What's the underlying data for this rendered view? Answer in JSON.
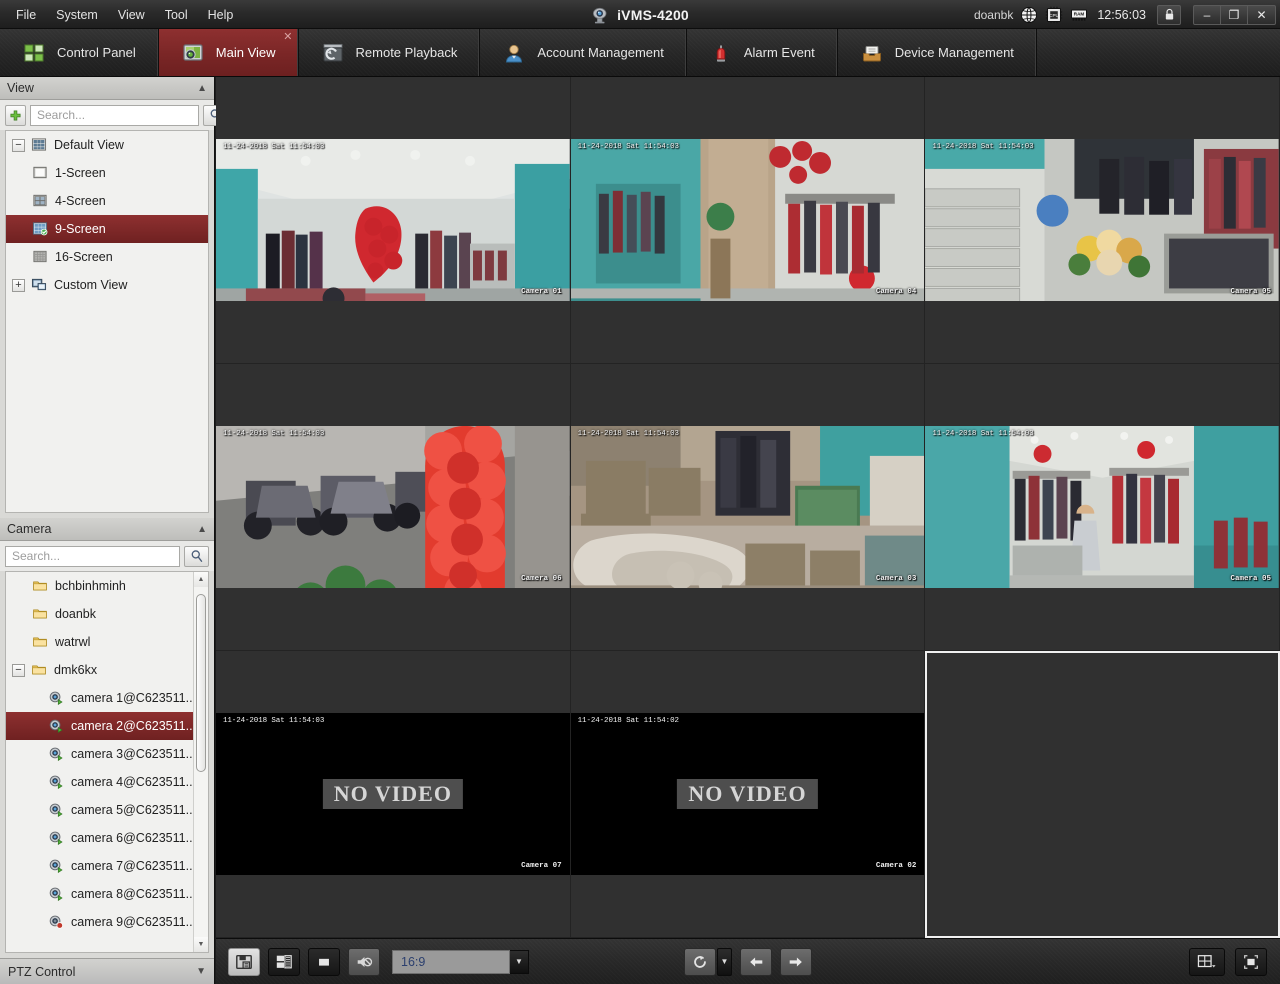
{
  "titlebar": {
    "menus": [
      "File",
      "System",
      "View",
      "Tool",
      "Help"
    ],
    "app_title": "iVMS-4200",
    "logo_icon": "camera-logo-icon",
    "user": "doanbk",
    "status_icons": [
      "globe-icon",
      "cpu-icon",
      "ram-icon"
    ],
    "time": "12:56:03",
    "lock_icon": "lock-icon",
    "minimize_label": "–",
    "restore_label": "❐",
    "close_label": "✕"
  },
  "tabs": [
    {
      "label": "Control Panel",
      "icon": "grid-panel-icon",
      "active": false,
      "closable": false
    },
    {
      "label": "Main View",
      "icon": "monitor-icon",
      "active": true,
      "closable": true,
      "close_label": "✕"
    },
    {
      "label": "Remote Playback",
      "icon": "playback-icon",
      "active": false,
      "closable": false
    },
    {
      "label": "Account Management",
      "icon": "user-icon",
      "active": false,
      "closable": false
    },
    {
      "label": "Alarm Event",
      "icon": "alarm-light-icon",
      "active": false,
      "closable": false
    },
    {
      "label": "Device Management",
      "icon": "device-box-icon",
      "active": false,
      "closable": false
    }
  ],
  "view_panel": {
    "title": "View",
    "collapse_icon": "chevron-up-icon",
    "add_icon": "plus-icon",
    "search_placeholder": "Search...",
    "search_value": "",
    "search_icon": "search-icon",
    "tree": [
      {
        "label": "Default View",
        "icon": "grid-view-icon",
        "expander": "−",
        "level": 0,
        "selected": false
      },
      {
        "label": "1-Screen",
        "icon": "screen-1-icon",
        "expander": "",
        "level": 1,
        "selected": false
      },
      {
        "label": "4-Screen",
        "icon": "screen-4-icon",
        "expander": "",
        "level": 1,
        "selected": false
      },
      {
        "label": "9-Screen",
        "icon": "screen-9-icon",
        "expander": "",
        "level": 1,
        "selected": true
      },
      {
        "label": "16-Screen",
        "icon": "screen-16-icon",
        "expander": "",
        "level": 1,
        "selected": false
      },
      {
        "label": "Custom View",
        "icon": "custom-view-icon",
        "expander": "+",
        "level": 0,
        "selected": false
      }
    ]
  },
  "camera_panel": {
    "title": "Camera",
    "collapse_icon": "chevron-up-icon",
    "search_placeholder": "Search...",
    "search_value": "",
    "search_icon": "search-icon",
    "tree": [
      {
        "label": "bchbinhminh",
        "icon": "folder-icon",
        "expander": "",
        "level": 1,
        "selected": false
      },
      {
        "label": "doanbk",
        "icon": "folder-icon",
        "expander": "",
        "level": 1,
        "selected": false
      },
      {
        "label": "watrwl",
        "icon": "folder-icon",
        "expander": "",
        "level": 1,
        "selected": false
      },
      {
        "label": "dmk6kx",
        "icon": "folder-icon",
        "expander": "−",
        "level": 0,
        "selected": false
      },
      {
        "label": "camera 1@C623511...",
        "icon": "camera-online-icon",
        "expander": "",
        "level": 2,
        "selected": false
      },
      {
        "label": "camera 2@C623511...",
        "icon": "camera-online-icon",
        "expander": "",
        "level": 2,
        "selected": true
      },
      {
        "label": "camera 3@C623511...",
        "icon": "camera-online-icon",
        "expander": "",
        "level": 2,
        "selected": false
      },
      {
        "label": "camera 4@C623511...",
        "icon": "camera-online-icon",
        "expander": "",
        "level": 2,
        "selected": false
      },
      {
        "label": "camera 5@C623511...",
        "icon": "camera-online-icon",
        "expander": "",
        "level": 2,
        "selected": false
      },
      {
        "label": "camera 6@C623511...",
        "icon": "camera-online-icon",
        "expander": "",
        "level": 2,
        "selected": false
      },
      {
        "label": "camera 7@C623511...",
        "icon": "camera-online-icon",
        "expander": "",
        "level": 2,
        "selected": false
      },
      {
        "label": "camera 8@C623511...",
        "icon": "camera-online-icon",
        "expander": "",
        "level": 2,
        "selected": false
      },
      {
        "label": "camera 9@C623511...",
        "icon": "camera-offline-icon",
        "expander": "",
        "level": 2,
        "selected": false
      }
    ],
    "scroll_up_icon": "scroll-up-arrow",
    "scroll_down_icon": "scroll-down-arrow"
  },
  "ptz_panel": {
    "title": "PTZ Control",
    "expand_icon": "chevron-down-icon"
  },
  "video_grid": {
    "layout": "9-Screen",
    "cells": [
      {
        "index": 1,
        "state": "live",
        "osd_time": "11-24-2018 Sat 11:54:03",
        "camera_label": "Camera 01",
        "scene": "boutique-teal",
        "selected": false
      },
      {
        "index": 2,
        "state": "live",
        "osd_time": "11-24-2018 Sat 11:54:03",
        "camera_label": "Camera 04",
        "scene": "boutique-racks",
        "selected": false
      },
      {
        "index": 3,
        "state": "live",
        "osd_time": "11-24-2018 Sat 11:54:03",
        "camera_label": "Camera 05",
        "scene": "stairwell-flowers",
        "selected": false
      },
      {
        "index": 4,
        "state": "live",
        "osd_time": "11-24-2018 Sat 11:54:03",
        "camera_label": "Camera 06",
        "scene": "street-scooters",
        "selected": false
      },
      {
        "index": 5,
        "state": "live",
        "osd_time": "11-24-2018 Sat 11:54:03",
        "camera_label": "Camera 03",
        "scene": "storage-room",
        "selected": false
      },
      {
        "index": 6,
        "state": "live",
        "osd_time": "11-24-2018 Sat 11:54:03",
        "camera_label": "Camera 05",
        "scene": "shop-aisle",
        "selected": false
      },
      {
        "index": 7,
        "state": "no-video",
        "osd_time": "11-24-2018 Sat 11:54:03",
        "camera_label": "Camera 07",
        "no_video_text": "NO VIDEO",
        "selected": false
      },
      {
        "index": 8,
        "state": "no-video",
        "osd_time": "11-24-2018 Sat 11:54:02",
        "camera_label": "Camera 02",
        "no_video_text": "NO VIDEO",
        "selected": false
      },
      {
        "index": 9,
        "state": "empty",
        "osd_time": "",
        "camera_label": "",
        "selected": true
      }
    ]
  },
  "toolbar": {
    "capture_icon": "capture-picture-icon",
    "layout_icon": "window-layout-icon",
    "stop_all_icon": "stop-icon",
    "audio_icon": "speaker-mute-icon",
    "aspect_ratio_value": "16:9",
    "aspect_ratio_dropdown_icon": "chevron-down-icon",
    "cycle_icon": "auto-switch-icon",
    "cycle_dropdown_icon": "chevron-down-icon",
    "prev_icon": "arrow-left-icon",
    "next_icon": "arrow-right-icon",
    "split_icon": "split-window-icon",
    "split_dropdown_icon": "chevron-down-icon",
    "fullscreen_icon": "fullscreen-icon"
  },
  "colors": {
    "accent_red": "#7a2626",
    "panel_gray": "#d9d9d6",
    "chrome_dark": "#272727",
    "selection_white": "#f0f0f0"
  }
}
